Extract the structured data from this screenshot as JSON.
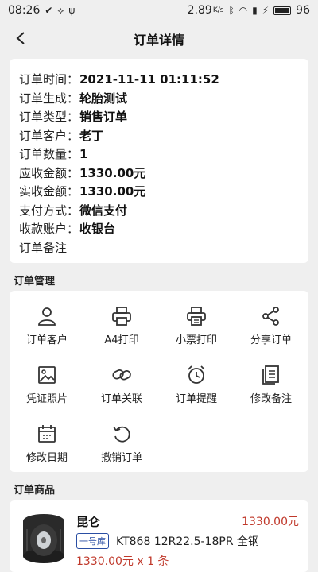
{
  "status": {
    "time": "08:26",
    "speed": "2.89",
    "speed_unit": "K/s",
    "battery": "96"
  },
  "header": {
    "title": "订单详情"
  },
  "order_info": [
    {
      "label": "订单时间：",
      "value": "2021-11-11 01:11:52"
    },
    {
      "label": "订单生成：",
      "value": "轮胎测试"
    },
    {
      "label": "订单类型：",
      "value": "销售订单"
    },
    {
      "label": "订单客户：",
      "value": "老丁"
    },
    {
      "label": "订单数量：",
      "value": "1"
    },
    {
      "label": "应收金额：",
      "value": "1330.00元"
    },
    {
      "label": "实收金额：",
      "value": "1330.00元"
    },
    {
      "label": "支付方式：",
      "value": "微信支付"
    },
    {
      "label": "收款账户：",
      "value": "收银台"
    },
    {
      "label": "订单备注",
      "value": ""
    }
  ],
  "management": {
    "title": "订单管理",
    "items": [
      {
        "label": "订单客户",
        "icon": "person-icon"
      },
      {
        "label": "A4打印",
        "icon": "printer-icon"
      },
      {
        "label": "小票打印",
        "icon": "receipt-printer-icon"
      },
      {
        "label": "分享订单",
        "icon": "share-icon"
      },
      {
        "label": "凭证照片",
        "icon": "image-icon"
      },
      {
        "label": "订单关联",
        "icon": "link-icon"
      },
      {
        "label": "订单提醒",
        "icon": "alarm-icon"
      },
      {
        "label": "修改备注",
        "icon": "note-icon"
      },
      {
        "label": "修改日期",
        "icon": "calendar-icon"
      },
      {
        "label": "撤销订单",
        "icon": "undo-icon"
      }
    ]
  },
  "goods": {
    "title": "订单商品",
    "brand": "昆仑",
    "price": "1330.00元",
    "tag": "一号库",
    "spec": "KT868 12R22.5-18PR 全钢",
    "price_qty": "1330.00元 x 1 条"
  },
  "colors": {
    "accent_price": "#c0392b",
    "tag_blue": "#2a4ea3"
  }
}
